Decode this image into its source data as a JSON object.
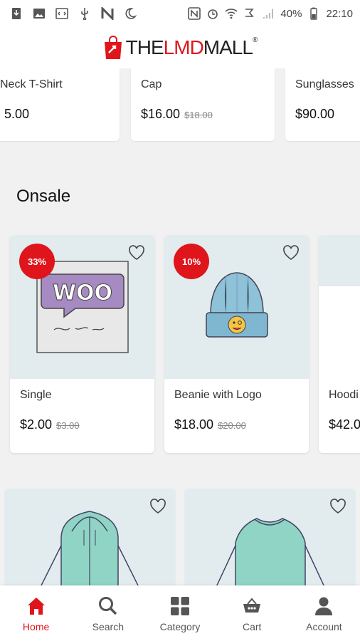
{
  "status_bar": {
    "battery": "40%",
    "time": "22:10"
  },
  "brand": {
    "the": "THE",
    "lmd": "LMD",
    "mall": "MALL",
    "reg": "®",
    "accent_color": "#e0151c"
  },
  "top_products": [
    {
      "name": "Neck T-Shirt",
      "price": "5.00",
      "old_price": ""
    },
    {
      "name": "Cap",
      "price": "$16.00",
      "old_price": "$18.00"
    },
    {
      "name": "Sunglasses",
      "price": "$90.00",
      "old_price": ""
    }
  ],
  "onsale": {
    "title": "Onsale",
    "items": [
      {
        "badge": "33%",
        "name": "Single",
        "price": "$2.00",
        "old_price": "$3.00",
        "image": "woo-single-poster"
      },
      {
        "badge": "10%",
        "name": "Beanie with Logo",
        "price": "$18.00",
        "old_price": "$20.00",
        "image": "blue-beanie"
      },
      {
        "badge": "",
        "name": "Hoodi",
        "price": "$42.0",
        "old_price": "",
        "image": "hoodie"
      }
    ]
  },
  "bottom_products": [
    {
      "image": "zip-hoodie"
    },
    {
      "image": "long-sleeve-tee"
    }
  ],
  "nav": {
    "items": [
      {
        "label": "Home",
        "icon": "home-icon",
        "active": true
      },
      {
        "label": "Search",
        "icon": "search-icon",
        "active": false
      },
      {
        "label": "Category",
        "icon": "grid-icon",
        "active": false
      },
      {
        "label": "Cart",
        "icon": "cart-icon",
        "active": false
      },
      {
        "label": "Account",
        "icon": "account-icon",
        "active": false
      }
    ]
  }
}
